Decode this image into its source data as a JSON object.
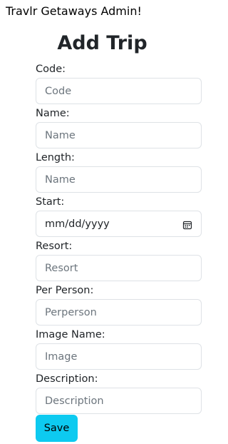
{
  "app": {
    "title": "Travlr Getaways Admin!"
  },
  "page": {
    "heading": "Add Trip"
  },
  "form": {
    "code": {
      "label": "Code:",
      "placeholder": "Code"
    },
    "name": {
      "label": "Name:",
      "placeholder": "Name"
    },
    "length": {
      "label": "Length:",
      "placeholder": "Name"
    },
    "start": {
      "label": "Start:",
      "value": "mm/dd/yyyy",
      "icon": "calendar-icon"
    },
    "resort": {
      "label": "Resort:",
      "placeholder": "Resort"
    },
    "per_person": {
      "label": "Per Person:",
      "placeholder": "Perperson"
    },
    "image": {
      "label": "Image Name:",
      "placeholder": "Image"
    },
    "description": {
      "label": "Description:",
      "placeholder": "Description"
    },
    "save_label": "Save"
  },
  "colors": {
    "button": "#0dcaf0",
    "border": "#dee2e6",
    "placeholder": "#6c757d"
  }
}
